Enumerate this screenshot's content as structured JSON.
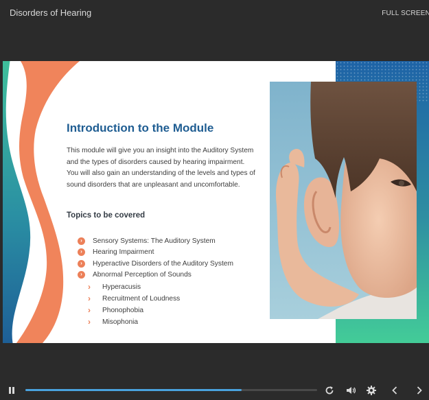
{
  "header": {
    "course_title": "Disorders of Hearing",
    "fullscreen_label": "FULL SCREEN"
  },
  "slide": {
    "heading": "Introduction to the Module",
    "intro": "This module will give you an insight into the Auditory System and the types of disorders caused by hearing impairment. You will also gain an understanding of the levels and types of sound disorders that are unpleasant and uncomfortable.",
    "topics_title": "Topics to be covered",
    "topics": [
      "Sensory Systems: The Auditory System",
      "Hearing Impairment",
      "Hyperactive Disorders of the Auditory System",
      "Abnormal Perception of Sounds"
    ],
    "subtopics": [
      "Hyperacusis",
      "Recruitment of Loudness",
      "Phonophobia",
      "Misophonia"
    ],
    "photo": "child cupping hand behind ear"
  },
  "player": {
    "progress_fraction": 0.74,
    "icons": [
      "pause-icon",
      "replay-icon",
      "volume-icon",
      "settings-icon",
      "previous-icon",
      "next-icon"
    ]
  },
  "colors": {
    "background": "#2b2b2b",
    "heading": "#1f5d92",
    "accent_orange": "#ec8059",
    "teal": "#3fbfa0",
    "progress": "#4aa3df"
  }
}
